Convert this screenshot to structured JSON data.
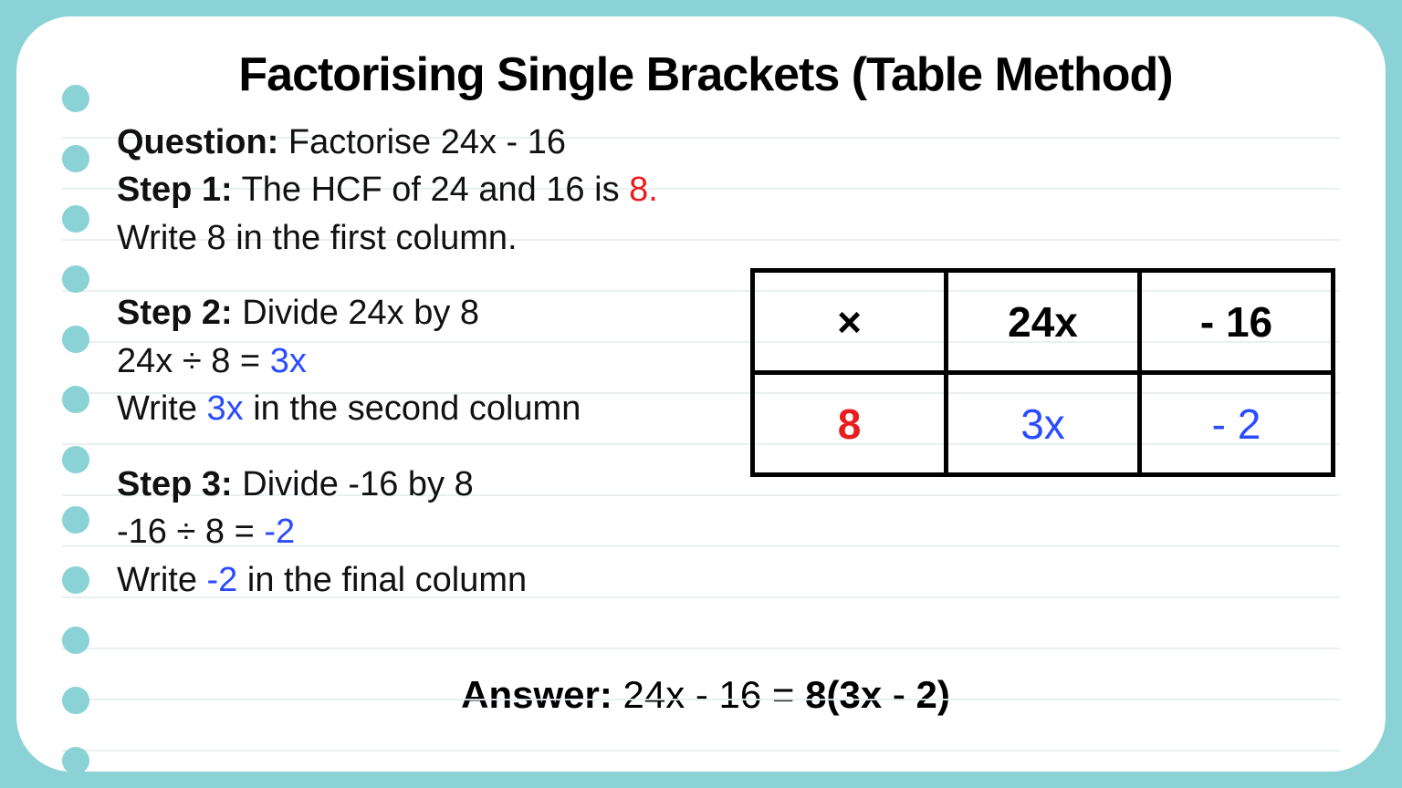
{
  "title": "Factorising Single Brackets (Table Method)",
  "question": {
    "label": "Question:",
    "text": " Factorise 24x - 16"
  },
  "step1": {
    "label": "Step 1:",
    "text_a": " The HCF of 24 and 16 is ",
    "highlight": "8",
    "dot": ".",
    "line2": "Write 8 in the first column."
  },
  "step2": {
    "label": "Step 2:",
    "text_a": " Divide 24x by 8",
    "line2_a": "24x ÷ 8 = ",
    "line2_hl": "3x",
    "line3_a": "Write ",
    "line3_hl": "3x",
    "line3_b": " in the second column"
  },
  "step3": {
    "label": "Step 3:",
    "text_a": " Divide -16 by 8",
    "line2_a": "-16 ÷ 8 = ",
    "line2_hl": "-2",
    "line3_a": "Write ",
    "line3_hl": "-2",
    "line3_b": " in the final column"
  },
  "table": {
    "r1c1": "×",
    "r1c2": "24x",
    "r1c3": "- 16",
    "r2c1": "8",
    "r2c2": "3x",
    "r2c3": "- 2"
  },
  "answer": {
    "label": "Answer:",
    "expr": " 24x - 16 =  ",
    "result": "8(3x - 2)"
  }
}
